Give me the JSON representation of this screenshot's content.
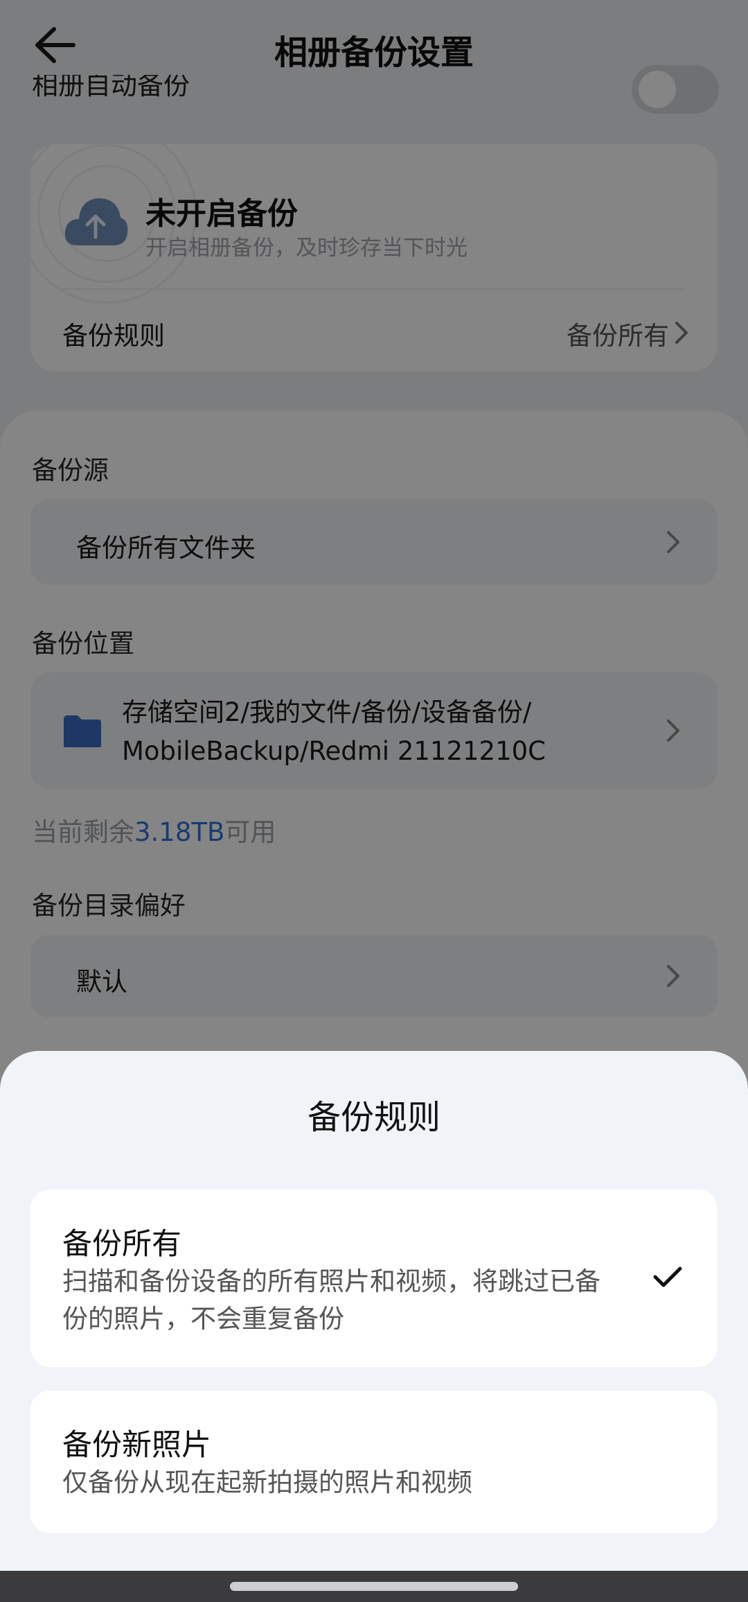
{
  "header": {
    "title": "相册备份设置",
    "partial_row": "相册自动备份"
  },
  "status": {
    "title": "未开启备份",
    "subtitle": "开启相册备份，及时珍存当下时光",
    "rule_label": "备份规则",
    "rule_value": "备份所有"
  },
  "source": {
    "label": "备份源",
    "value": "备份所有文件夹"
  },
  "location": {
    "label": "备份位置",
    "line1": "存储空间2/我的文件/备份/设备备份/",
    "line2": "MobileBackup/Redmi 21121210C"
  },
  "remain": {
    "prefix": "当前剩余",
    "amount": "3.18TB",
    "suffix": "可用"
  },
  "dir_pref": {
    "label": "备份目录偏好",
    "value": "默认"
  },
  "sheet": {
    "title": "备份规则",
    "options": [
      {
        "title": "备份所有",
        "desc_line1": "扫描和备份设备的所有照片和视频，将跳过已备",
        "desc_line2": "份的照片，不会重复备份",
        "selected": true
      },
      {
        "title": "备份新照片",
        "desc_line1": "仅备份从现在起新拍摄的照片和视频",
        "selected": false
      }
    ]
  },
  "colors": {
    "accent": "#2f6fd6",
    "overlay": "rgba(0,0,0,0.48)"
  }
}
